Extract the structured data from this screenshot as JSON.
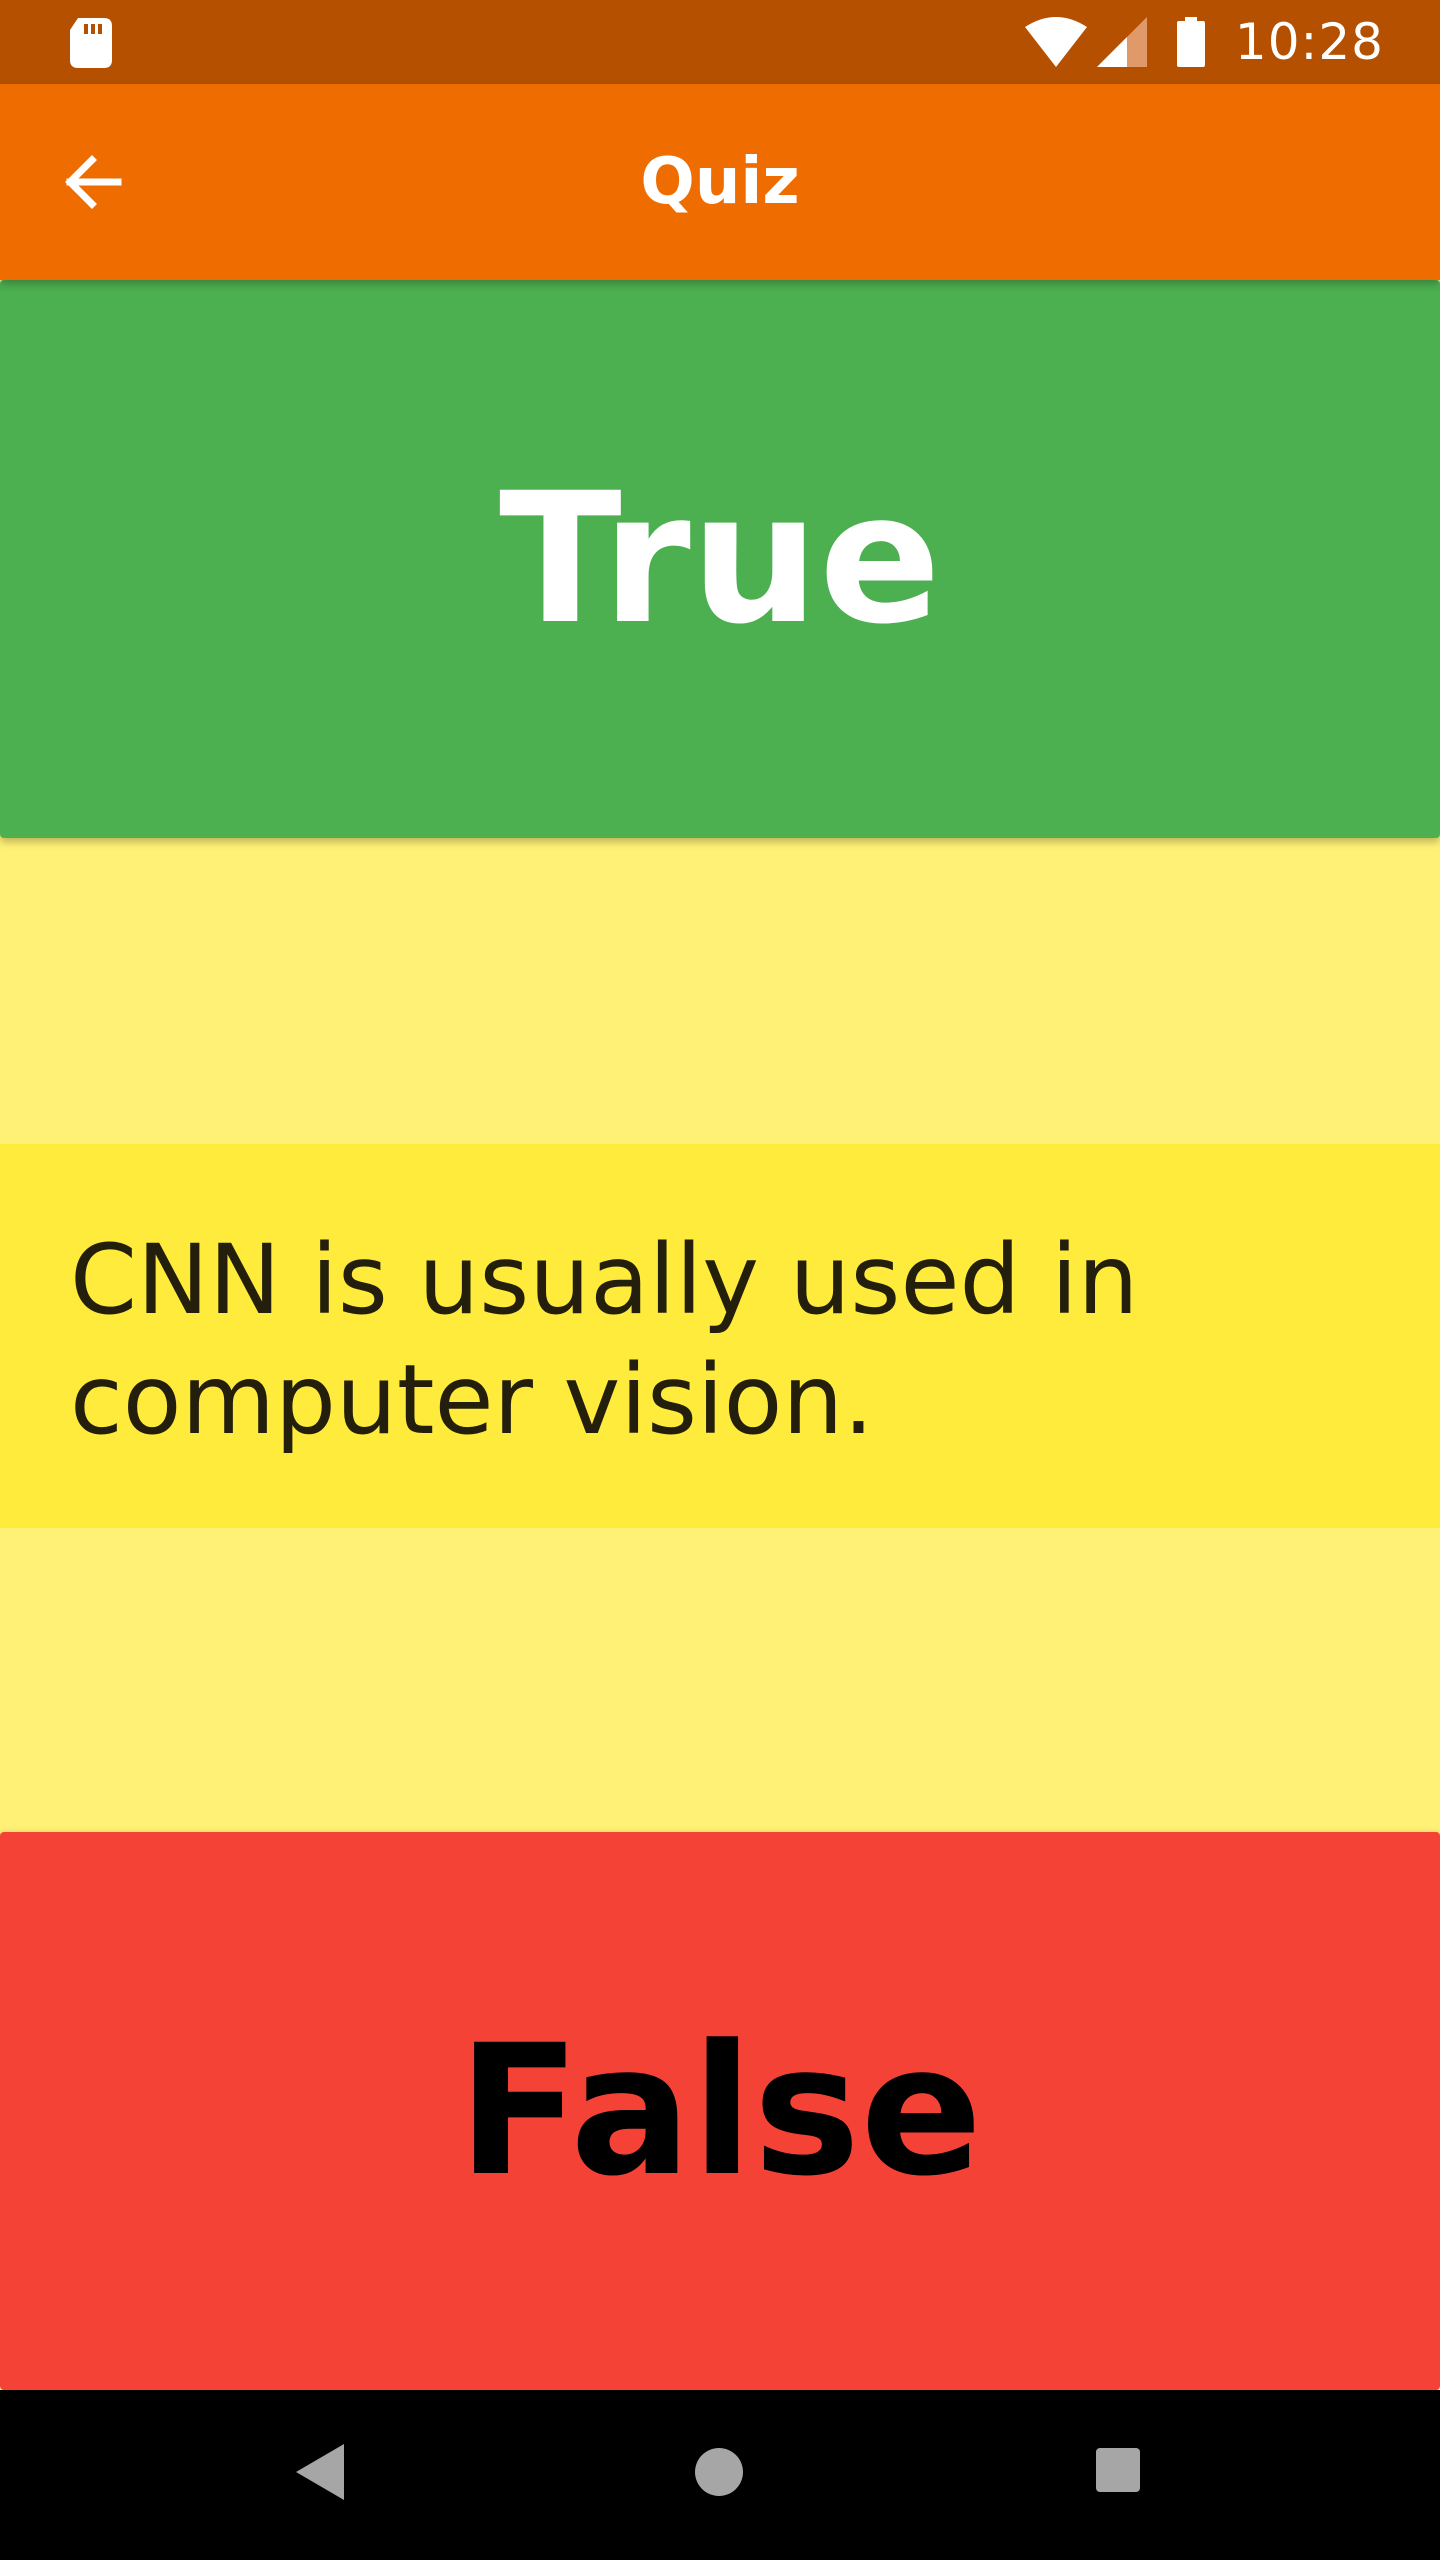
{
  "status_bar": {
    "time": "10:28",
    "icons": [
      "sd-card-icon",
      "wifi-icon",
      "signal-icon",
      "battery-icon"
    ]
  },
  "app_bar": {
    "title": "Quiz",
    "back_icon": "arrow-back-icon"
  },
  "quiz": {
    "true_label": "True",
    "question": "CNN is usually used in computer vision.",
    "false_label": "False"
  },
  "nav_bar": {
    "icons": [
      "nav-back-icon",
      "nav-home-icon",
      "nav-recents-icon"
    ]
  },
  "colors": {
    "status_bar": "#b45000",
    "app_bar": "#ef6c00",
    "true_button": "#4caf50",
    "false_button": "#f44336",
    "background": "#fff176",
    "question_panel": "#ffeb3b"
  }
}
